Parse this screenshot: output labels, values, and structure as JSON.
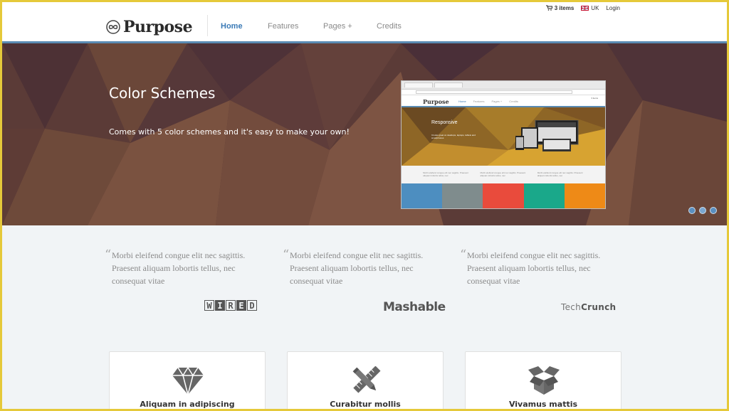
{
  "utility": {
    "cart_label": "3 items",
    "language_label": "UK",
    "login_label": "Login"
  },
  "logo": {
    "text": "Purpose"
  },
  "nav": {
    "items": [
      {
        "label": "Home",
        "active": true
      },
      {
        "label": "Features"
      },
      {
        "label": "Pages +"
      },
      {
        "label": "Credits"
      }
    ]
  },
  "hero": {
    "title": "Color Schemes",
    "subtitle": "Comes with 5 color schemes and it's easy to make your own!",
    "slides": 3,
    "active_slide": 2,
    "preview": {
      "logo": "Purpose",
      "nav": [
        "Home",
        "Features",
        "Pages +",
        "Credits"
      ],
      "title": "Responsive",
      "text": "It looks great on desktops, laptops, tablets and smartphones",
      "quote": "Morbi eleifend congue elit nec sagittis. Praesent aliquam lobortis tellus, nec",
      "swatches": [
        "#4d8ec0",
        "#7f8c8d",
        "#e94b3c",
        "#1aa88a",
        "#ee8a17"
      ]
    }
  },
  "testimonials": [
    {
      "text": "Morbi eleifend congue elit nec sagittis. Praesent aliquam lobortis tellus, nec consequat vitae",
      "brand": "WIRED"
    },
    {
      "text": "Morbi eleifend congue elit nec sagittis. Praesent aliquam lobortis tellus, nec consequat vitae",
      "brand": "Mashable"
    },
    {
      "text": "Morbi eleifend congue elit nec sagittis. Praesent aliquam lobortis tellus, nec consequat vitae",
      "brand_prefix": "Tech",
      "brand_suffix": "Crunch"
    }
  ],
  "features": [
    {
      "title": "Aliquam in adipiscing",
      "icon": "diamond-icon"
    },
    {
      "title": "Curabitur mollis",
      "icon": "pencil-ruler-icon"
    },
    {
      "title": "Vivamus mattis",
      "icon": "open-box-icon"
    }
  ],
  "colors": {
    "accent": "#3a7ab6",
    "header_border": "#5a8bb3",
    "hero_bg": "#5a3a36",
    "frame_border": "#e5c93a"
  }
}
